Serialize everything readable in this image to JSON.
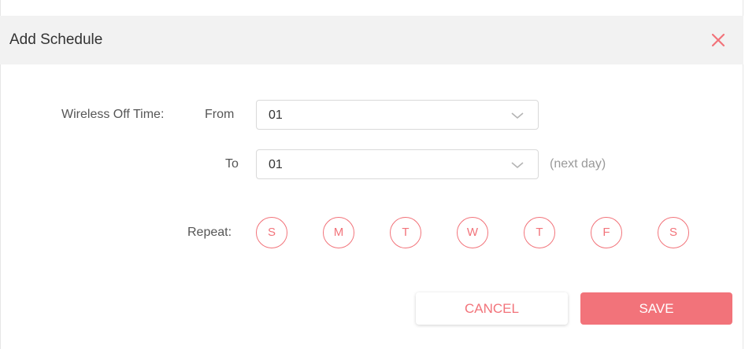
{
  "dialog": {
    "title": "Add Schedule",
    "close_icon": "close-icon",
    "accent_color": "#f2737a"
  },
  "off_time": {
    "label": "Wireless Off Time:",
    "from_label": "From",
    "from_value": "01",
    "to_label": "To",
    "to_value": "01",
    "to_hint": "(next day)"
  },
  "repeat": {
    "label": "Repeat:",
    "days": [
      "S",
      "M",
      "T",
      "W",
      "T",
      "F",
      "S"
    ]
  },
  "actions": {
    "cancel_label": "CANCEL",
    "save_label": "SAVE"
  }
}
